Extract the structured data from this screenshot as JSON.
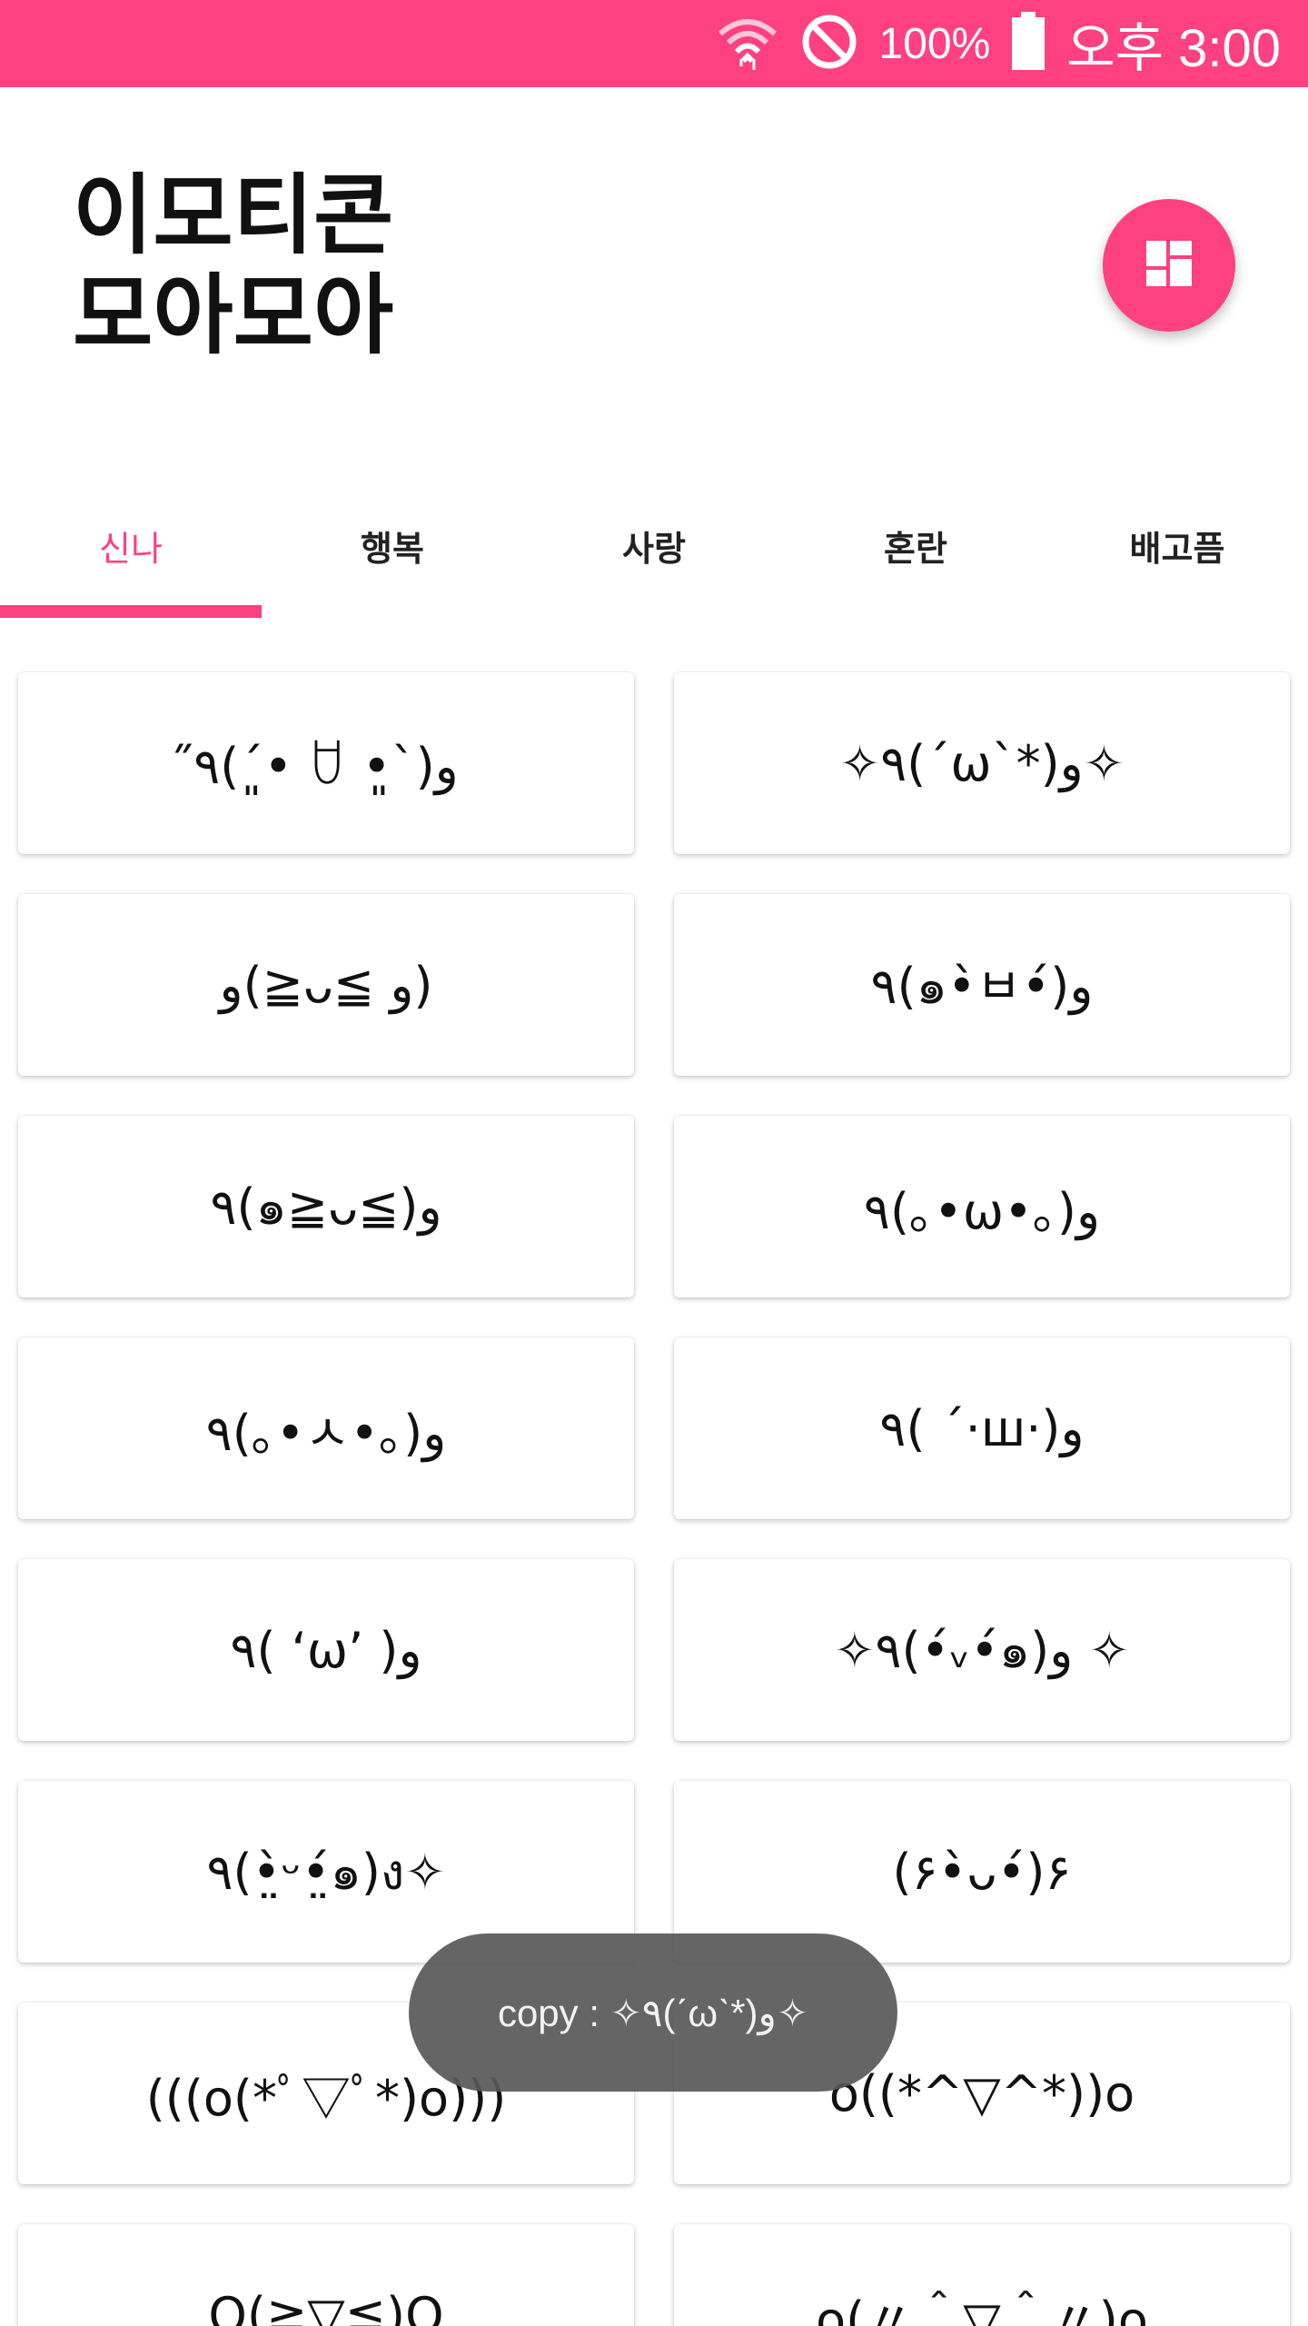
{
  "status_bar": {
    "battery": "100%",
    "time": "오후 3:00",
    "color": "#ff4081",
    "icons": [
      "wifi-icon",
      "do-not-disturb-icon",
      "battery-icon"
    ]
  },
  "header": {
    "title_line1": "이모티콘",
    "title_line2": "모아모아",
    "fab_icon": "dashboard-icon"
  },
  "tabs": {
    "items": [
      "신나",
      "행복",
      "사랑",
      "혼란",
      "배고픔"
    ],
    "active_index": 0
  },
  "emoticons": [
    "٩̋(ˊ•͈ ꇴ •͈ˋ)و",
    "✧٩(ˊωˋ*)و✧",
    "و(≧ᴗ≦ و)",
    "٩(๑•̀ㅂ•́)و",
    "٩(๑≧ᴗ≦)و",
    "٩(｡•ω•｡)و",
    "٩(｡•ㅅ•｡)و",
    "٩( ˊ·ш·)و",
    "٩( ‘ω’ )و",
    "✧٩(•́ᵥ•́๑)و ✧",
    "٩(•̤̀ᵕ•̤́๑)ง✧",
    "(۶•̀ᴗ•́)۶",
    "(((o(*ﾟ▽ﾟ*)o)))",
    "o((*^▽^*))o",
    "O(≧▽≦)O",
    "o(〃＾▽＾〃)o"
  ],
  "toast": {
    "text": "copy : ✧٩(ˊωˋ*)و✧"
  },
  "colors": {
    "accent": "#ff4081",
    "toast_bg": "#5a5a5a"
  }
}
